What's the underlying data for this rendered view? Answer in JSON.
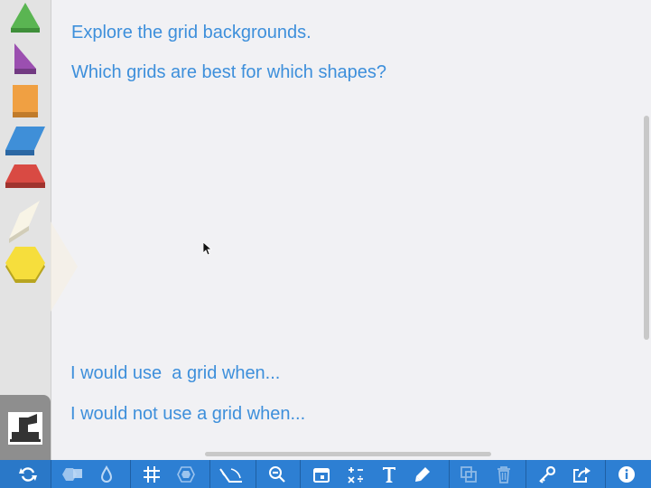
{
  "canvas": {
    "prompt_line1": "Explore the grid backgrounds.",
    "prompt_line2": "Which grids are best for which shapes?",
    "answer_line1": "I would use  a grid when...",
    "answer_line2": "I would not use a grid when..."
  },
  "palette": {
    "shapes": [
      "green-triangle",
      "purple-right-triangle",
      "orange-square",
      "blue-rhombus",
      "red-trapezoid",
      "tan-thin-rhombus",
      "yellow-hexagon"
    ],
    "tool": "stamp-icon"
  },
  "toolbar": {
    "icons": [
      "refresh-icon",
      "shapes-icon",
      "color-drop-icon",
      "grid-icon",
      "hexagon-grid-icon",
      "angle-icon",
      "zoom-out-icon",
      "calendar-icon",
      "math-operations-icon",
      "text-icon",
      "highlighter-icon",
      "duplicate-icon",
      "trash-icon",
      "key-icon",
      "share-icon",
      "info-icon"
    ]
  },
  "colors": {
    "accent": "#2d7fd3",
    "text": "#3d8fdb",
    "canvas": "#f1f1f4",
    "palette": "#e3e3e3"
  }
}
